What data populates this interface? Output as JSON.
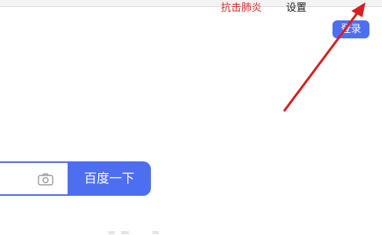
{
  "top_nav": {
    "alert_link": "抗击肺炎",
    "settings_link": "设置",
    "login_button": "登录"
  },
  "search": {
    "input_value": "",
    "submit_label": "百度一下",
    "camera_icon": "camera-icon"
  },
  "colors": {
    "accent": "#4e6ef2",
    "alert": "#d62c2c",
    "annotation_arrow": "#d81e1e"
  }
}
